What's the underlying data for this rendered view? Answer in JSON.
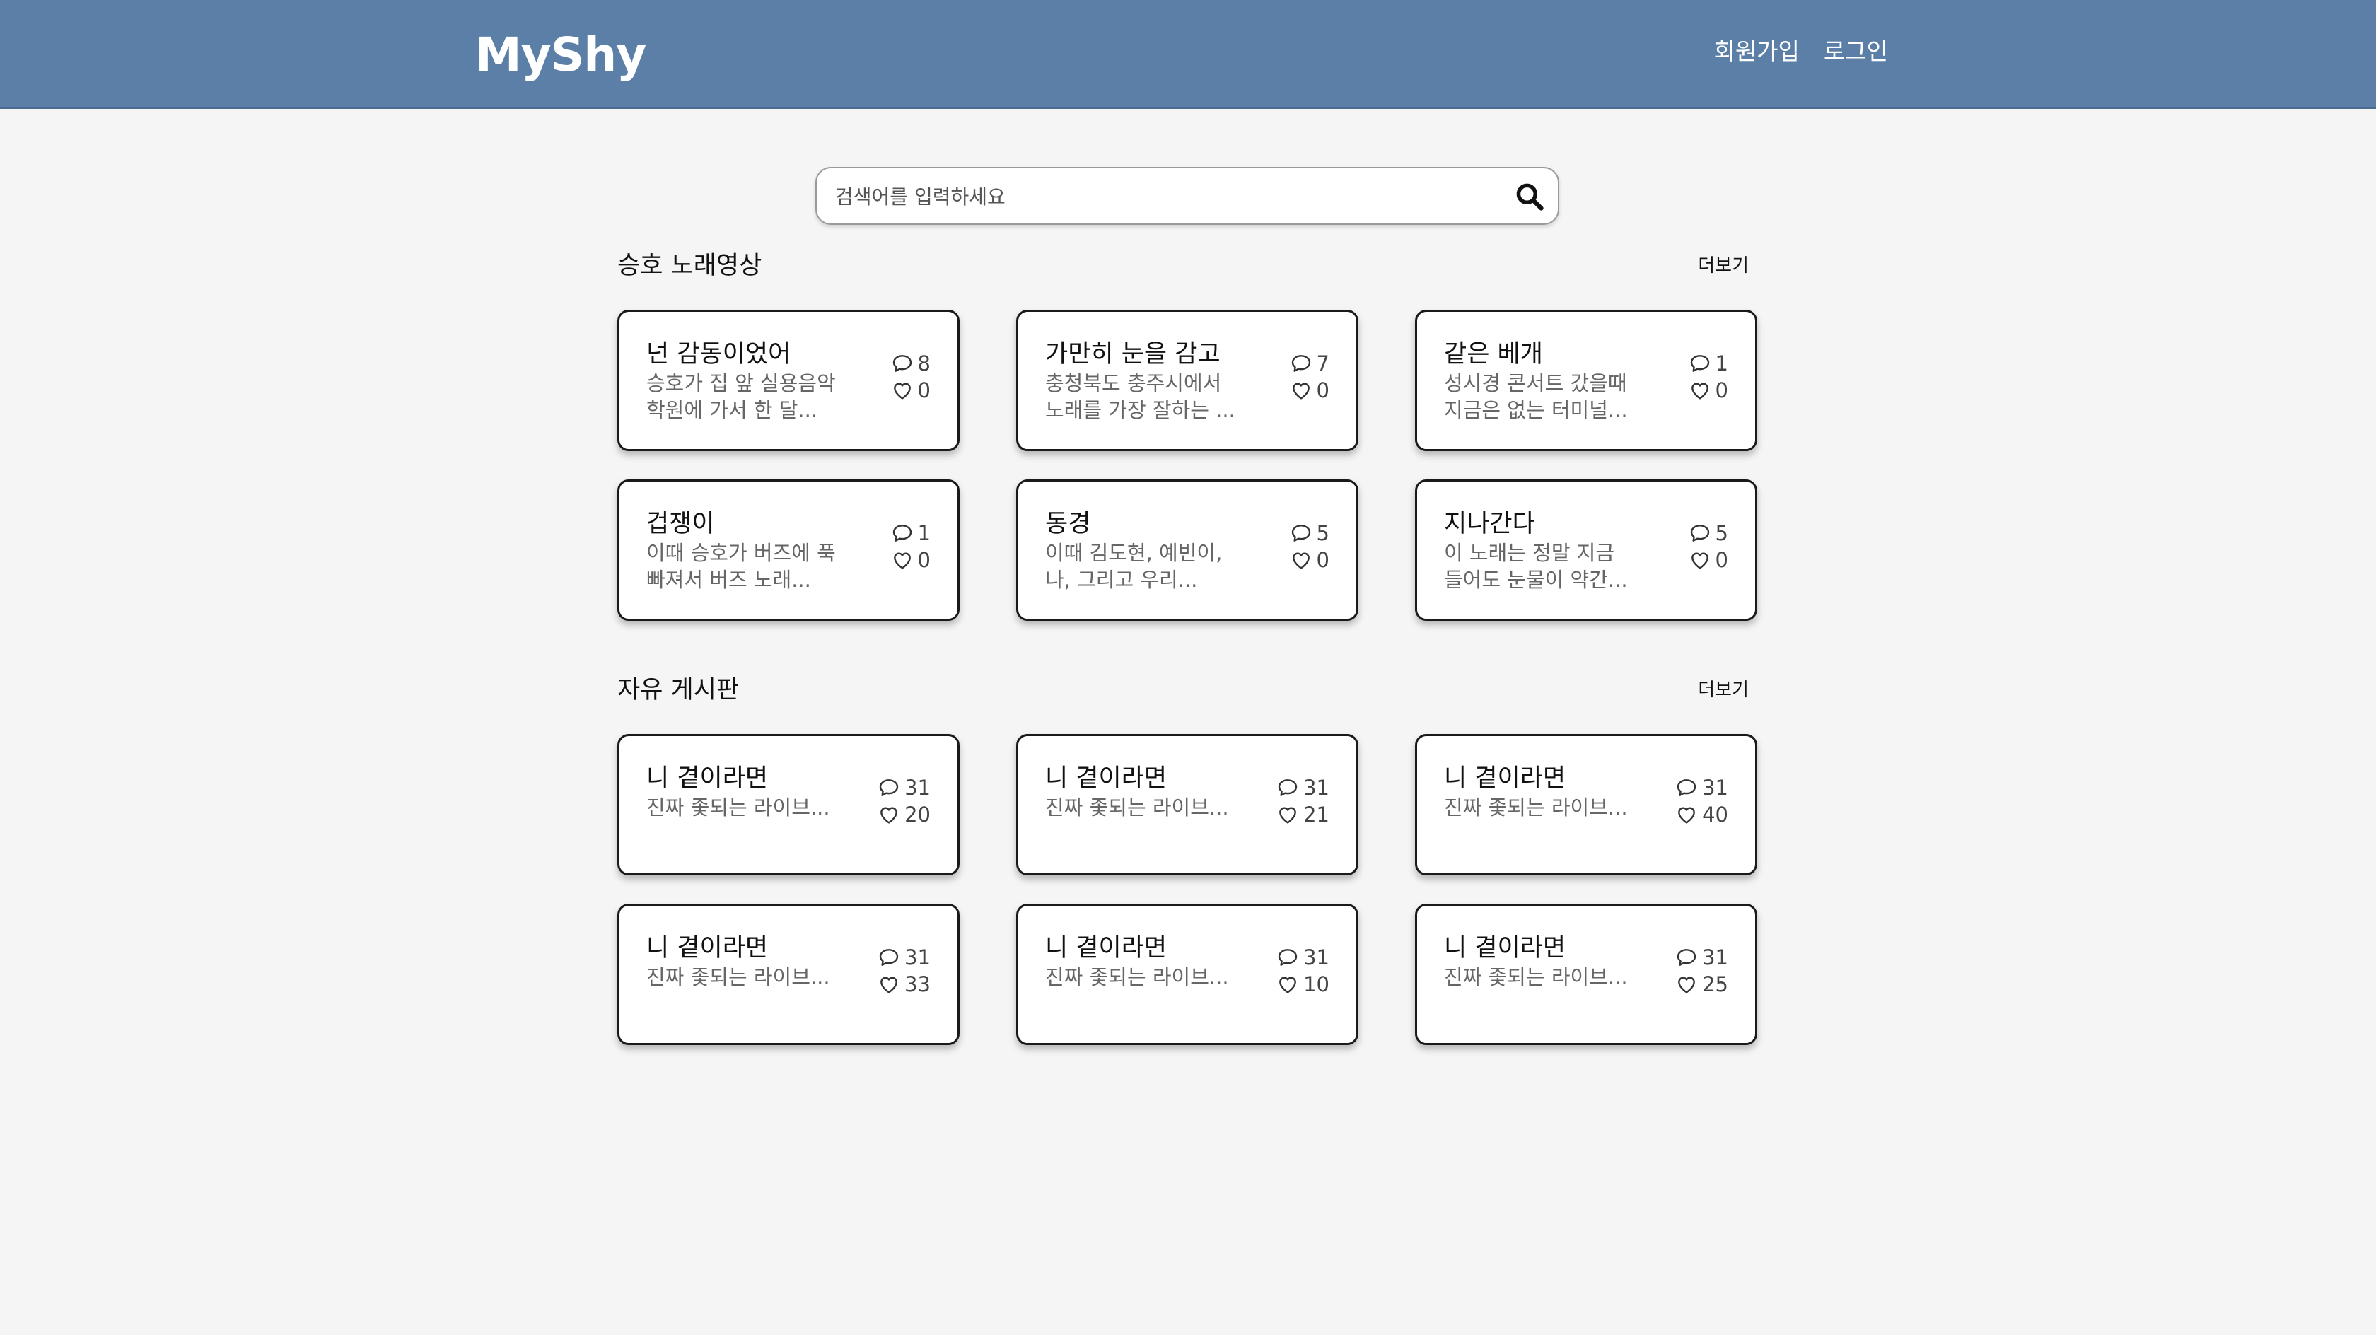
{
  "header": {
    "logo": "MyShy",
    "nav": {
      "signup": "회원가입",
      "login": "로그인"
    },
    "color": "#5b7fa6"
  },
  "search": {
    "placeholder": "검색어를 입력하세요",
    "icon": "search-icon"
  },
  "sections": [
    {
      "title": "승호 노래영상",
      "more": "더보기",
      "cards": [
        {
          "title": "넌 감동이었어",
          "desc1": "승호가 집 앞 실용음악",
          "desc2": "학원에 가서 한 달...",
          "comments": "8",
          "likes": "0"
        },
        {
          "title": "가만히 눈을 감고",
          "desc1": "충청북도 충주시에서",
          "desc2": "노래를 가장 잘하는 ...",
          "comments": "7",
          "likes": "0"
        },
        {
          "title": "같은 베개",
          "desc1": "성시경 콘서트 갔을때",
          "desc2": "지금은 없는 터미널...",
          "comments": "1",
          "likes": "0"
        },
        {
          "title": "겁쟁이",
          "desc1": "이때 승호가 버즈에 푹",
          "desc2": "빠져서 버즈 노래...",
          "comments": "1",
          "likes": "0"
        },
        {
          "title": "동경",
          "desc1": "이때 김도현, 예빈이,",
          "desc2": "나, 그리고 우리...",
          "comments": "5",
          "likes": "0"
        },
        {
          "title": "지나간다",
          "desc1": "이 노래는 정말 지금",
          "desc2": "들어도 눈물이 약간...",
          "comments": "5",
          "likes": "0"
        }
      ]
    },
    {
      "title": "자유 게시판",
      "more": "더보기",
      "cards": [
        {
          "title": "니 곁이라면",
          "desc1": "진짜 좇되는 라이브...",
          "desc2": "",
          "comments": "31",
          "likes": "20"
        },
        {
          "title": "니 곁이라면",
          "desc1": "진짜 좇되는 라이브...",
          "desc2": "",
          "comments": "31",
          "likes": "21"
        },
        {
          "title": "니 곁이라면",
          "desc1": "진짜 좇되는 라이브...",
          "desc2": "",
          "comments": "31",
          "likes": "40"
        },
        {
          "title": "니 곁이라면",
          "desc1": "진짜 좇되는 라이브...",
          "desc2": "",
          "comments": "31",
          "likes": "33"
        },
        {
          "title": "니 곁이라면",
          "desc1": "진짜 좇되는 라이브...",
          "desc2": "",
          "comments": "31",
          "likes": "10"
        },
        {
          "title": "니 곁이라면",
          "desc1": "진짜 좇되는 라이브...",
          "desc2": "",
          "comments": "31",
          "likes": "25"
        }
      ]
    }
  ]
}
